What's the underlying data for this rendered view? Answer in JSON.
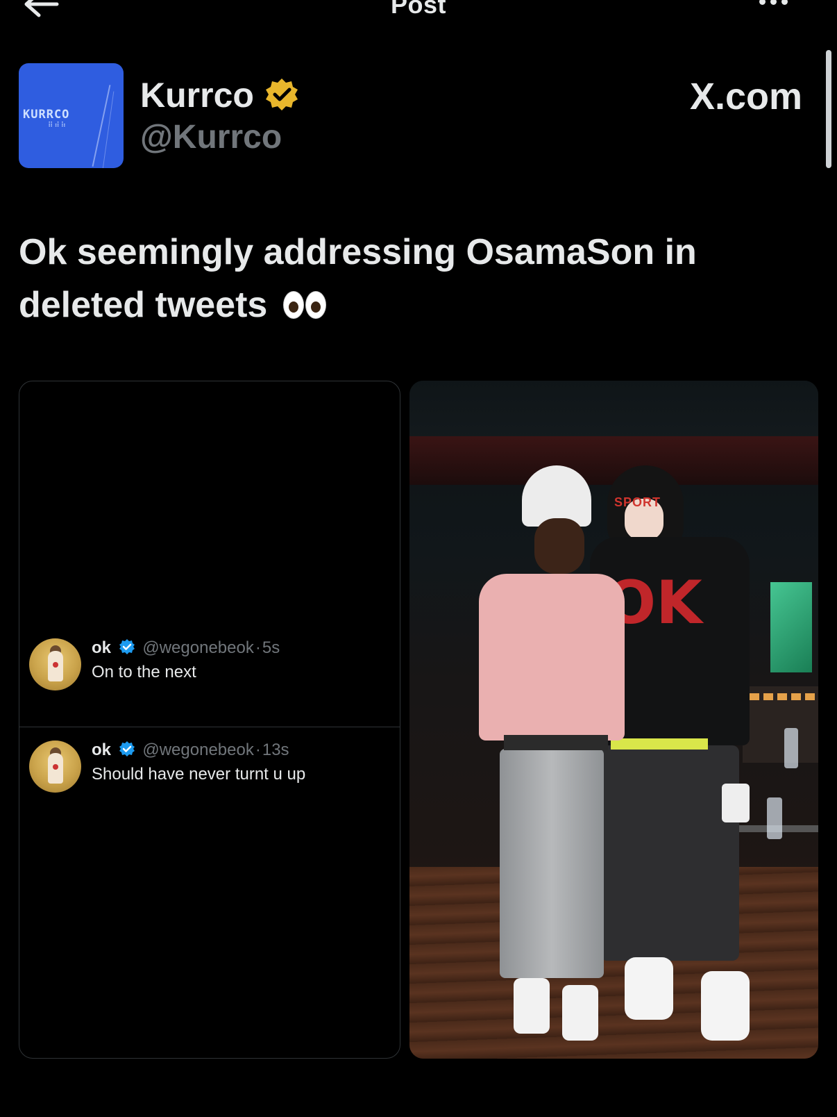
{
  "top_bar": {
    "title": "Post"
  },
  "author": {
    "display_name": "Kurrco",
    "handle": "@Kurrco",
    "avatar_text": "KURRCO",
    "source": "X.com"
  },
  "post": {
    "text": "Ok seemingly addressing OsamaSon in deleted tweets"
  },
  "quoted_tweets": [
    {
      "name": "ok",
      "handle": "@wegonebeok",
      "separator": "·",
      "time": "5s",
      "text": "On to the next"
    },
    {
      "name": "ok",
      "handle": "@wegonebeok",
      "separator": "·",
      "time": "13s",
      "text": "Should have never turnt u up"
    }
  ],
  "photo": {
    "hood_text": "SPORT",
    "shirt_text": "OK"
  },
  "colors": {
    "background": "#000000",
    "text": "#e7e9ea",
    "muted": "#71767b",
    "gold_badge": "#e8b62c",
    "blue_badge": "#1d9bf0",
    "border": "#2f3336"
  },
  "icons": [
    "back-arrow-icon",
    "more-icon",
    "verified-gold-icon",
    "verified-blue-icon",
    "eyes-emoji-icon"
  ]
}
